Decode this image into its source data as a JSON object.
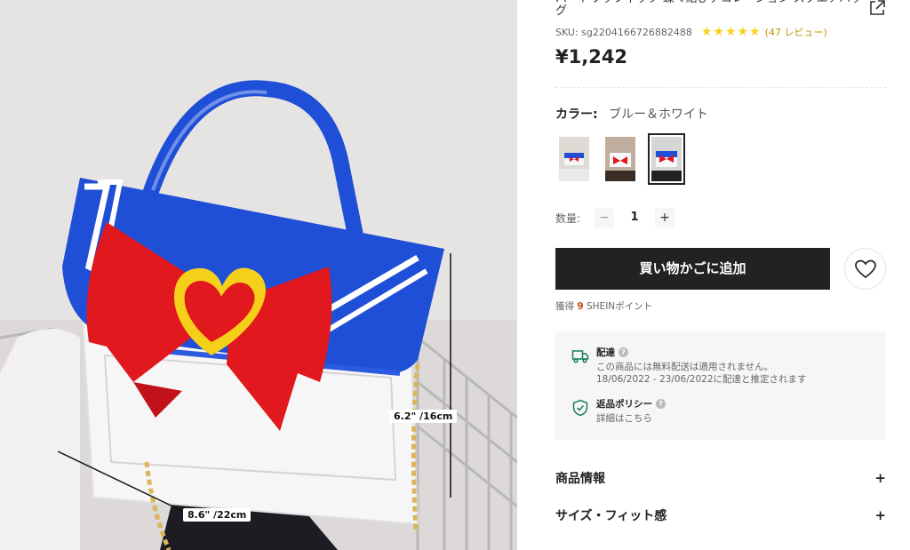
{
  "product": {
    "title": "パートワッフィック 蝶々結びデコレーション スクエアバッグ",
    "sku_label": "SKU: sg2204166726882488",
    "rating_stars": 5,
    "reviews_text": "(47 レビュー)",
    "price": "¥1,242"
  },
  "photo": {
    "height_label": "6.2\" /16cm",
    "width_label": "8.6\" /22cm"
  },
  "color": {
    "label": "カラー:",
    "value": "ブルー＆ホワイト",
    "swatches": [
      {
        "name": "variant-1",
        "active": false
      },
      {
        "name": "variant-2",
        "active": false
      },
      {
        "name": "variant-3",
        "active": true
      }
    ]
  },
  "quantity": {
    "label": "数量:",
    "minus": "−",
    "value": "1",
    "plus": "+"
  },
  "cart": {
    "add_label": "買い物かごに追加"
  },
  "points": {
    "prefix": "獲得",
    "count": "9",
    "suffix": "SHEINポイント"
  },
  "shipping": {
    "title": "配達",
    "line1": "この商品には無料配送は適用されません。",
    "line2": "18/06/2022 - 23/06/2022に配達と推定されます",
    "return_title": "返品ポリシー",
    "return_link": "詳細はこちら"
  },
  "accordions": [
    {
      "label": "商品情報",
      "icon": "+"
    },
    {
      "label": "サイズ・フィット感",
      "icon": "+"
    }
  ],
  "colors": {
    "accent_star": "#facf19",
    "button_bg": "#222222",
    "points_orange": "#c44a01",
    "ship_icon_green": "#198055"
  }
}
